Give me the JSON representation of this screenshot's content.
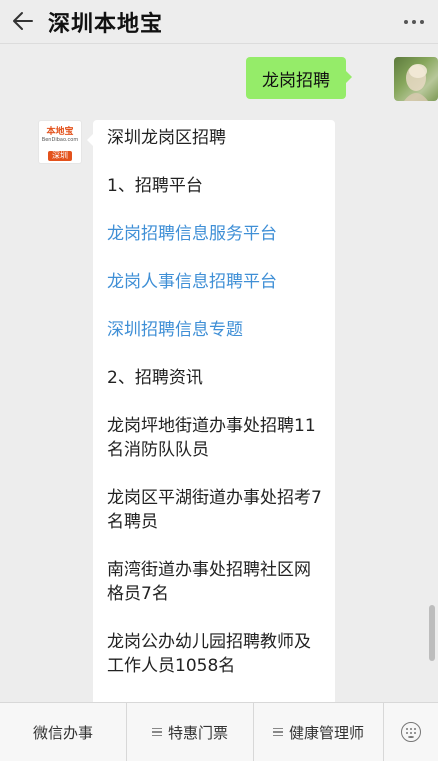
{
  "header": {
    "title": "深圳本地宝"
  },
  "user_message": {
    "text": "龙岗招聘"
  },
  "bot": {
    "avatar": {
      "logo_text": "本地宝",
      "logo_url": "BenDibao.com",
      "city": "深圳"
    },
    "lines": [
      {
        "text": "深圳龙岗区招聘",
        "link": false
      },
      {
        "text": "1、招聘平台",
        "link": false
      },
      {
        "text": "龙岗招聘信息服务平台",
        "link": true
      },
      {
        "text": "龙岗人事信息招聘平台",
        "link": true
      },
      {
        "text": "深圳招聘信息专题",
        "link": true
      },
      {
        "text": "2、招聘资讯",
        "link": false
      },
      {
        "text": "龙岗坪地街道办事处招聘11名消防队队员",
        "link": true
      },
      {
        "text": "龙岗区平湖街道办事处招考7名聘员",
        "link": true
      },
      {
        "text": "南湾街道办事处招聘社区网格员7名",
        "link": true
      },
      {
        "text": "龙岗公办幼儿园招聘教师及工作人员1058名",
        "link": true
      }
    ]
  },
  "menu": {
    "items": [
      {
        "label": "微信办事",
        "has_icon": false
      },
      {
        "label": "特惠门票",
        "has_icon": true
      },
      {
        "label": "健康管理师",
        "has_icon": true
      }
    ]
  },
  "icons": {
    "back": "back-arrow-icon",
    "more": "more-dots-icon",
    "menu": "menu-lines-icon",
    "keyboard": "keyboard-icon"
  },
  "colors": {
    "user_bubble": "#95ec69",
    "link": "#3f8fd6",
    "logo_accent": "#e3521c"
  }
}
